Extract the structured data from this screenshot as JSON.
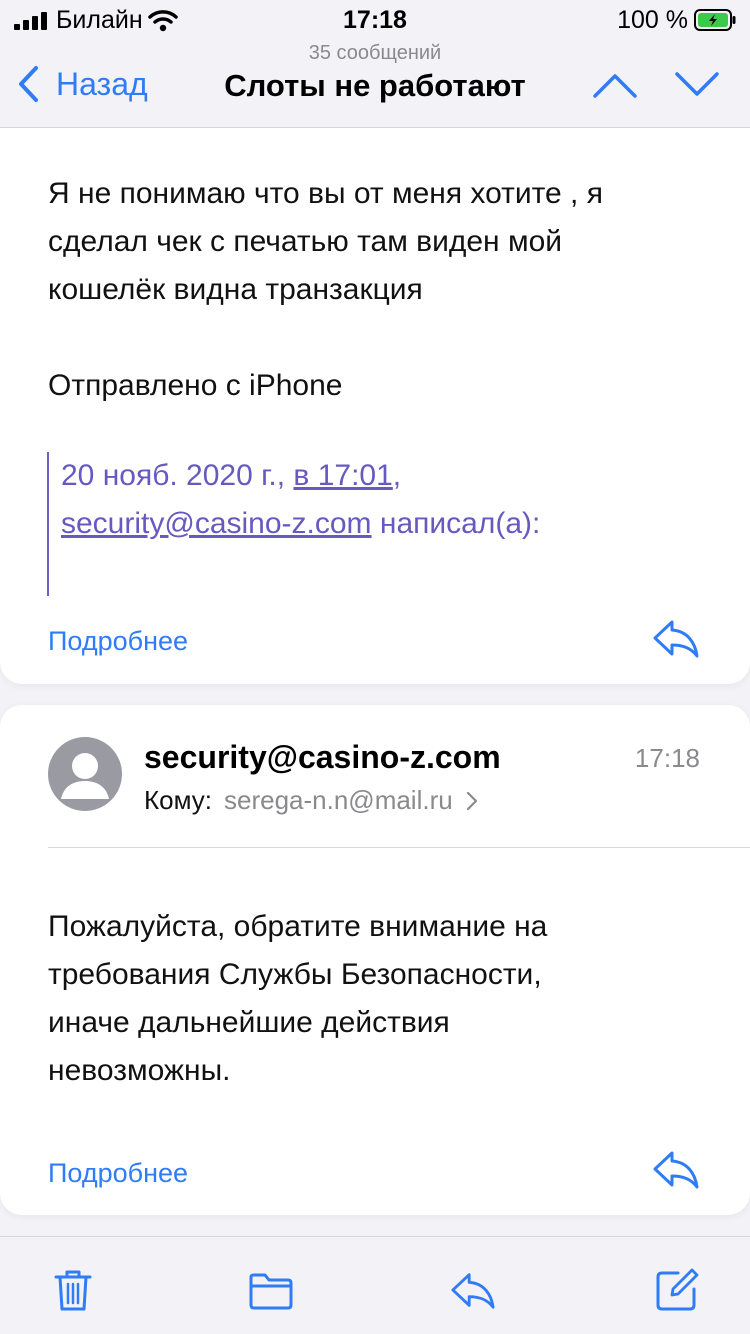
{
  "status_bar": {
    "carrier": "Билайн",
    "time": "17:18",
    "battery_percent": "100 %"
  },
  "nav": {
    "message_count": "35 сообщений",
    "back_label": "Назад",
    "title": "Слоты не работают"
  },
  "message1": {
    "body_line1": "Я не понимаю что вы от меня хотите , я",
    "body_line2": "сделал чек с печатью там виден мой",
    "body_line3": "кошелёк видна транзакция",
    "signature": "Отправлено с iPhone",
    "quote_date": "20 нояб. 2020 г.,",
    "quote_time": "в 17:01",
    "quote_sep": ",",
    "quote_email": "security@casino-z.com",
    "quote_wrote": "написал(а):",
    "more_label": "Подробнее"
  },
  "message2": {
    "sender": "security@casino-z.com",
    "time": "17:18",
    "to_label": "Кому:",
    "to_address": "serega-n.n@mail.ru",
    "body_line1": "Пожалуйста, обратите внимание на",
    "body_line2": "требования Службы Безопасности,",
    "body_line3": "иначе дальнейшие действия",
    "body_line4": "невозможны.",
    "more_label": "Подробнее"
  },
  "colors": {
    "accent": "#2f7cf6",
    "quote": "#6659c0",
    "battery": "#3dc94a"
  },
  "icons": [
    "signal-icon",
    "wifi-icon",
    "battery-icon",
    "back-chevron-icon",
    "up-arrow-icon",
    "down-arrow-icon",
    "reply-icon",
    "avatar-icon",
    "chevron-right-icon",
    "trash-icon",
    "folder-icon",
    "compose-icon"
  ]
}
